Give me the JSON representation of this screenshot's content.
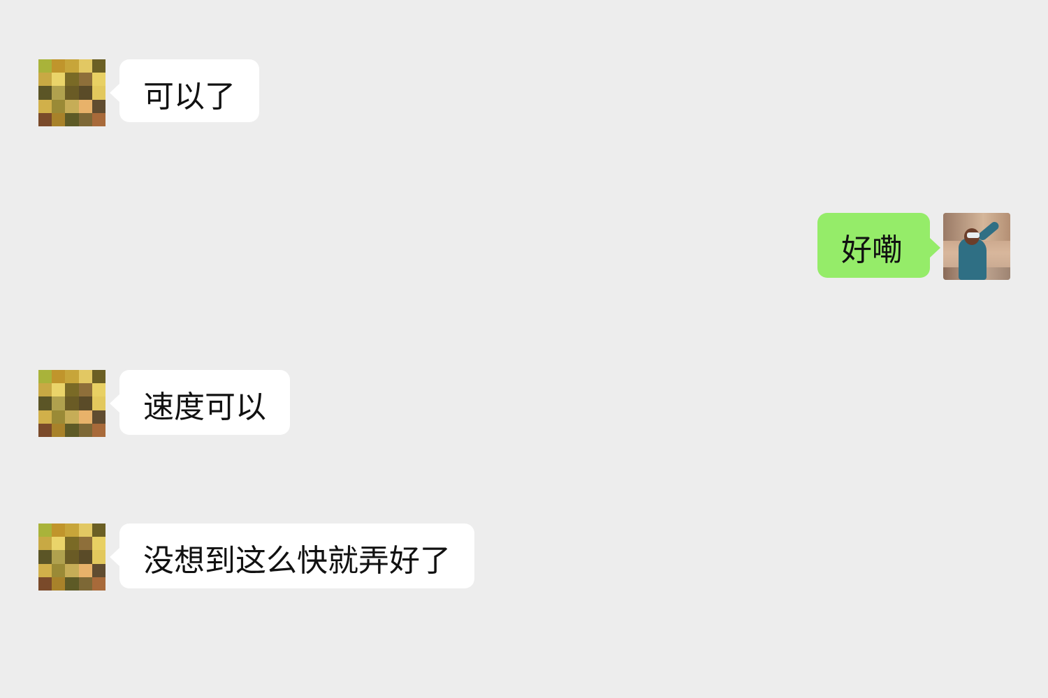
{
  "chat": {
    "messages": [
      {
        "side": "left",
        "text": "可以了"
      },
      {
        "side": "right",
        "text": "好嘞"
      },
      {
        "side": "left",
        "text": "速度可以"
      },
      {
        "side": "left",
        "text": "没想到这么快就弄好了"
      }
    ]
  },
  "colors": {
    "background": "#ededed",
    "incoming_bubble": "#ffffff",
    "outgoing_bubble": "#95ec69",
    "text": "#111111"
  },
  "icons": {
    "contact_avatar": "pixelated-avatar-icon",
    "self_avatar": "photo-avatar-icon"
  }
}
